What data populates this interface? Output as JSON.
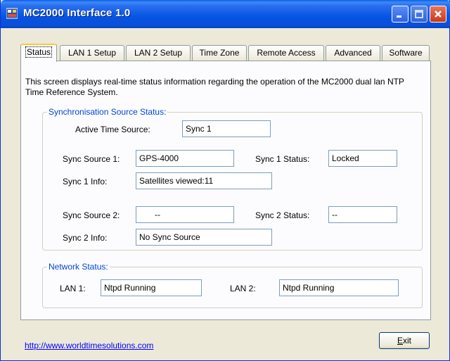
{
  "window": {
    "title": "MC2000 Interface 1.0"
  },
  "tabs": [
    {
      "label": "Status"
    },
    {
      "label": "LAN 1 Setup"
    },
    {
      "label": "LAN 2 Setup"
    },
    {
      "label": "Time Zone"
    },
    {
      "label": "Remote Access"
    },
    {
      "label": "Advanced"
    },
    {
      "label": "Software"
    }
  ],
  "status": {
    "description": "This screen displays real-time status information regarding the operation of the MC2000 dual lan NTP Time Reference System.",
    "sync_group": {
      "title": "Synchronisation Source Status:",
      "active_time_source_label": "Active Time Source:",
      "active_time_source_value": "Sync 1",
      "sync_source_1_label": "Sync Source 1:",
      "sync_source_1_value": "GPS-4000",
      "sync_1_status_label": "Sync 1 Status:",
      "sync_1_status_value": "Locked",
      "sync_1_info_label": "Sync 1 Info:",
      "sync_1_info_value": "Satellites viewed:11",
      "sync_source_2_label": "Sync Source 2:",
      "sync_source_2_value": "--",
      "sync_2_status_label": "Sync 2 Status:",
      "sync_2_status_value": "--",
      "sync_2_info_label": "Sync 2 Info:",
      "sync_2_info_value": "No Sync Source"
    },
    "network_group": {
      "title": "Network Status:",
      "lan1_label": "LAN 1:",
      "lan1_value": "Ntpd Running",
      "lan2_label": "LAN 2:",
      "lan2_value": "Ntpd Running"
    }
  },
  "footer": {
    "link_text": "http://www.worldtimesolutions.com",
    "exit_label_underlined": "E",
    "exit_label_rest": "xit"
  }
}
